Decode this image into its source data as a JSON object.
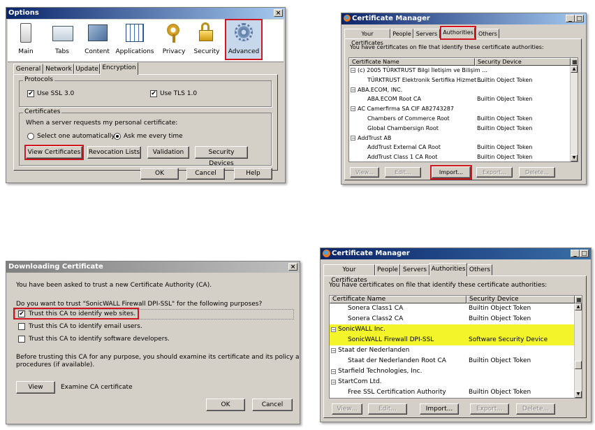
{
  "options": {
    "title": "Options",
    "categories": [
      "Main",
      "Tabs",
      "Content",
      "Applications",
      "Privacy",
      "Security",
      "Advanced"
    ],
    "subtabs": [
      "General",
      "Network",
      "Update",
      "Encryption"
    ],
    "protocols_label": "Protocols",
    "ssl_label": "Use SSL 3.0",
    "tls_label": "Use TLS 1.0",
    "certificates_label": "Certificates",
    "request_text": "When a server requests my personal certificate:",
    "radio_auto": "Select one automatically",
    "radio_ask": "Ask me every time",
    "view_certs": "View Certificates",
    "revocation": "Revocation Lists",
    "validation": "Validation",
    "security_devices": "Security Devices",
    "ok": "OK",
    "cancel": "Cancel",
    "help": "Help",
    "close_glyph": "×"
  },
  "cm1": {
    "title": "Certificate Manager",
    "tabs": [
      "Your Certificates",
      "People",
      "Servers",
      "Authorities",
      "Others"
    ],
    "intro": "You have certificates on file that identify these certificate authorities:",
    "col_name": "Certificate Name",
    "col_device": "Security Device",
    "rows": [
      {
        "name": "(c) 2005 TÜRKTRUST Bilgi İletişim ve Bilişim ...",
        "device": "",
        "group": true
      },
      {
        "name": "TÜRKTRUST Elektronik Sertifika Hizmet ...",
        "device": "Builtin Object Token",
        "group": false
      },
      {
        "name": "ABA.ECOM, INC.",
        "device": "",
        "group": true
      },
      {
        "name": "ABA.ECOM Root CA",
        "device": "Builtin Object Token",
        "group": false
      },
      {
        "name": "AC Camerfirma SA CIF A82743287",
        "device": "",
        "group": true
      },
      {
        "name": "Chambers of Commerce Root",
        "device": "Builtin Object Token",
        "group": false
      },
      {
        "name": "Global Chambersign Root",
        "device": "Builtin Object Token",
        "group": false
      },
      {
        "name": "AddTrust AB",
        "device": "",
        "group": true
      },
      {
        "name": "AddTrust External CA Root",
        "device": "Builtin Object Token",
        "group": false
      },
      {
        "name": "AddTrust Class 1 CA Root",
        "device": "Builtin Object Token",
        "group": false
      }
    ],
    "buttons": [
      "View...",
      "Edit...",
      "Import...",
      "Export...",
      "Delete..."
    ]
  },
  "dl": {
    "title": "Downloading Certificate",
    "line1": "You have been asked to trust a new Certificate Authority (CA).",
    "line2": "Do you want to trust \"SonicWALL Firewall DPI-SSL\" for the following purposes?",
    "opt1": "Trust this CA to identify web sites.",
    "opt2": "Trust this CA to identify email users.",
    "opt3": "Trust this CA to identify software developers.",
    "line3a": "Before trusting this CA for any purpose, you should examine its certificate and its policy and",
    "line3b": "procedures (if available).",
    "view": "View",
    "examine": "Examine CA certificate",
    "ok": "OK",
    "cancel": "Cancel",
    "close_glyph": "×"
  },
  "cm2": {
    "title": "Certificate Manager",
    "tabs": [
      "Your Certificates",
      "People",
      "Servers",
      "Authorities",
      "Others"
    ],
    "intro": "You have certificates on file that identify these certificate authorities:",
    "col_name": "Certificate Name",
    "col_device": "Security Device",
    "rows": [
      {
        "name": "Sonera Class1 CA",
        "device": "Builtin Object Token",
        "group": false,
        "hl": false
      },
      {
        "name": "Sonera Class2 CA",
        "device": "Builtin Object Token",
        "group": false,
        "hl": false
      },
      {
        "name": "SonicWALL Inc.",
        "device": "",
        "group": true,
        "hl": true
      },
      {
        "name": "SonicWALL Firewall DPI-SSL",
        "device": "Software Security Device",
        "group": false,
        "hl": true
      },
      {
        "name": "Staat der Nederlanden",
        "device": "",
        "group": true,
        "hl": false
      },
      {
        "name": "Staat der Nederlanden Root CA",
        "device": "Builtin Object Token",
        "group": false,
        "hl": false
      },
      {
        "name": "Starfield Technologies, Inc.",
        "device": "",
        "group": true,
        "hl": false
      },
      {
        "name": "StartCom Ltd.",
        "device": "",
        "group": true,
        "hl": false
      },
      {
        "name": "Free SSL Certification Authority",
        "device": "Builtin Object Token",
        "group": false,
        "hl": false
      }
    ],
    "buttons": [
      "View...",
      "Edit...",
      "Import...",
      "Export...",
      "Delete..."
    ]
  }
}
